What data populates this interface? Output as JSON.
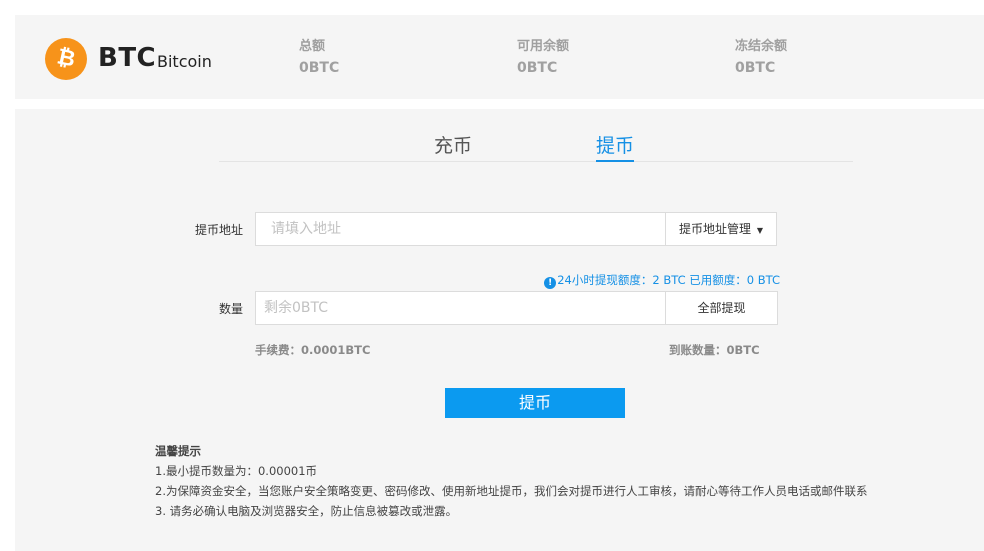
{
  "coin": {
    "symbol": "BTC",
    "name": "Bitcoin",
    "icon_glyph": "₿",
    "icon": "bitcoin-icon",
    "brand_color": "#f7931a"
  },
  "balances": [
    {
      "label": "总额",
      "value": "0BTC"
    },
    {
      "label": "可用余额",
      "value": "0BTC"
    },
    {
      "label": "冻结余额",
      "value": "0BTC"
    }
  ],
  "tabs": [
    {
      "label": "充币",
      "active": false
    },
    {
      "label": "提币",
      "active": true
    }
  ],
  "form": {
    "address_label": "提币地址",
    "address_placeholder": "请填入地址",
    "address_value": "",
    "address_manage_label": "提币地址管理",
    "limit_info_icon": "!",
    "limit_info": "24小时提现额度：2 BTC 已用额度：0 BTC",
    "amount_label": "数量",
    "amount_placeholder": "剩余0BTC",
    "amount_value": "",
    "withdraw_all_label": "全部提现",
    "fee_text": "手续费：0.0001BTC",
    "received_text": "到账数量：0BTC",
    "submit_label": "提币"
  },
  "tips": {
    "title": "温馨提示",
    "items": [
      "1.最小提币数量为：0.00001币",
      "2.为保障资金安全，当您账户安全策略变更、密码修改、使用新地址提币，我们会对提币进行人工审核，请耐心等待工作人员电话或邮件联系",
      "3. 请务必确认电脑及浏览器安全，防止信息被篡改或泄露。"
    ]
  },
  "colors": {
    "accent": "#1590e5",
    "button": "#0b9af0",
    "panel_bg": "#f5f5f5"
  }
}
